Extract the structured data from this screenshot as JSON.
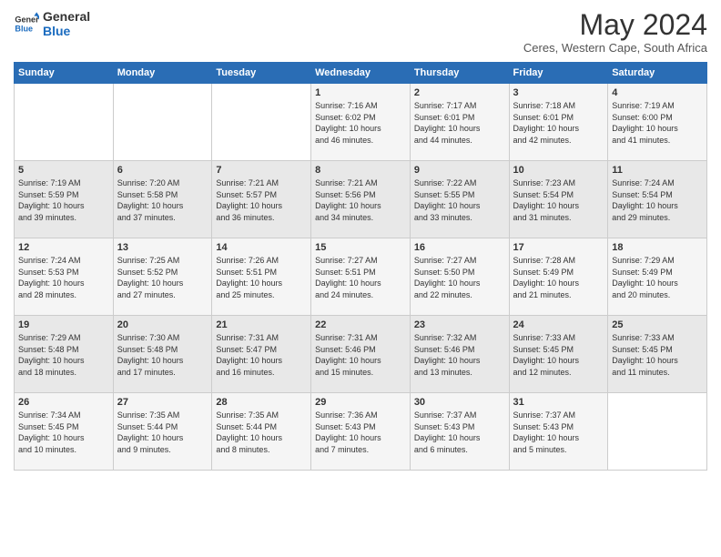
{
  "logo": {
    "line1": "General",
    "line2": "Blue"
  },
  "title": "May 2024",
  "subtitle": "Ceres, Western Cape, South Africa",
  "days_of_week": [
    "Sunday",
    "Monday",
    "Tuesday",
    "Wednesday",
    "Thursday",
    "Friday",
    "Saturday"
  ],
  "weeks": [
    [
      {
        "day": "",
        "info": ""
      },
      {
        "day": "",
        "info": ""
      },
      {
        "day": "",
        "info": ""
      },
      {
        "day": "1",
        "info": "Sunrise: 7:16 AM\nSunset: 6:02 PM\nDaylight: 10 hours\nand 46 minutes."
      },
      {
        "day": "2",
        "info": "Sunrise: 7:17 AM\nSunset: 6:01 PM\nDaylight: 10 hours\nand 44 minutes."
      },
      {
        "day": "3",
        "info": "Sunrise: 7:18 AM\nSunset: 6:01 PM\nDaylight: 10 hours\nand 42 minutes."
      },
      {
        "day": "4",
        "info": "Sunrise: 7:19 AM\nSunset: 6:00 PM\nDaylight: 10 hours\nand 41 minutes."
      }
    ],
    [
      {
        "day": "5",
        "info": "Sunrise: 7:19 AM\nSunset: 5:59 PM\nDaylight: 10 hours\nand 39 minutes."
      },
      {
        "day": "6",
        "info": "Sunrise: 7:20 AM\nSunset: 5:58 PM\nDaylight: 10 hours\nand 37 minutes."
      },
      {
        "day": "7",
        "info": "Sunrise: 7:21 AM\nSunset: 5:57 PM\nDaylight: 10 hours\nand 36 minutes."
      },
      {
        "day": "8",
        "info": "Sunrise: 7:21 AM\nSunset: 5:56 PM\nDaylight: 10 hours\nand 34 minutes."
      },
      {
        "day": "9",
        "info": "Sunrise: 7:22 AM\nSunset: 5:55 PM\nDaylight: 10 hours\nand 33 minutes."
      },
      {
        "day": "10",
        "info": "Sunrise: 7:23 AM\nSunset: 5:54 PM\nDaylight: 10 hours\nand 31 minutes."
      },
      {
        "day": "11",
        "info": "Sunrise: 7:24 AM\nSunset: 5:54 PM\nDaylight: 10 hours\nand 29 minutes."
      }
    ],
    [
      {
        "day": "12",
        "info": "Sunrise: 7:24 AM\nSunset: 5:53 PM\nDaylight: 10 hours\nand 28 minutes."
      },
      {
        "day": "13",
        "info": "Sunrise: 7:25 AM\nSunset: 5:52 PM\nDaylight: 10 hours\nand 27 minutes."
      },
      {
        "day": "14",
        "info": "Sunrise: 7:26 AM\nSunset: 5:51 PM\nDaylight: 10 hours\nand 25 minutes."
      },
      {
        "day": "15",
        "info": "Sunrise: 7:27 AM\nSunset: 5:51 PM\nDaylight: 10 hours\nand 24 minutes."
      },
      {
        "day": "16",
        "info": "Sunrise: 7:27 AM\nSunset: 5:50 PM\nDaylight: 10 hours\nand 22 minutes."
      },
      {
        "day": "17",
        "info": "Sunrise: 7:28 AM\nSunset: 5:49 PM\nDaylight: 10 hours\nand 21 minutes."
      },
      {
        "day": "18",
        "info": "Sunrise: 7:29 AM\nSunset: 5:49 PM\nDaylight: 10 hours\nand 20 minutes."
      }
    ],
    [
      {
        "day": "19",
        "info": "Sunrise: 7:29 AM\nSunset: 5:48 PM\nDaylight: 10 hours\nand 18 minutes."
      },
      {
        "day": "20",
        "info": "Sunrise: 7:30 AM\nSunset: 5:48 PM\nDaylight: 10 hours\nand 17 minutes."
      },
      {
        "day": "21",
        "info": "Sunrise: 7:31 AM\nSunset: 5:47 PM\nDaylight: 10 hours\nand 16 minutes."
      },
      {
        "day": "22",
        "info": "Sunrise: 7:31 AM\nSunset: 5:46 PM\nDaylight: 10 hours\nand 15 minutes."
      },
      {
        "day": "23",
        "info": "Sunrise: 7:32 AM\nSunset: 5:46 PM\nDaylight: 10 hours\nand 13 minutes."
      },
      {
        "day": "24",
        "info": "Sunrise: 7:33 AM\nSunset: 5:45 PM\nDaylight: 10 hours\nand 12 minutes."
      },
      {
        "day": "25",
        "info": "Sunrise: 7:33 AM\nSunset: 5:45 PM\nDaylight: 10 hours\nand 11 minutes."
      }
    ],
    [
      {
        "day": "26",
        "info": "Sunrise: 7:34 AM\nSunset: 5:45 PM\nDaylight: 10 hours\nand 10 minutes."
      },
      {
        "day": "27",
        "info": "Sunrise: 7:35 AM\nSunset: 5:44 PM\nDaylight: 10 hours\nand 9 minutes."
      },
      {
        "day": "28",
        "info": "Sunrise: 7:35 AM\nSunset: 5:44 PM\nDaylight: 10 hours\nand 8 minutes."
      },
      {
        "day": "29",
        "info": "Sunrise: 7:36 AM\nSunset: 5:43 PM\nDaylight: 10 hours\nand 7 minutes."
      },
      {
        "day": "30",
        "info": "Sunrise: 7:37 AM\nSunset: 5:43 PM\nDaylight: 10 hours\nand 6 minutes."
      },
      {
        "day": "31",
        "info": "Sunrise: 7:37 AM\nSunset: 5:43 PM\nDaylight: 10 hours\nand 5 minutes."
      },
      {
        "day": "",
        "info": ""
      }
    ]
  ]
}
